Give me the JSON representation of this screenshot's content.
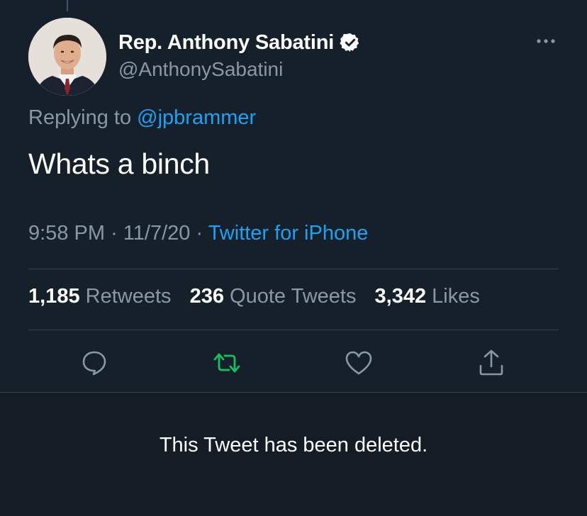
{
  "tweet": {
    "author": {
      "display_name": "Rep. Anthony Sabatini",
      "handle": "@AnthonySabatini",
      "verified": true
    },
    "replying_prefix": "Replying to",
    "replying_to": "@jpbrammer",
    "text": "Whats a binch",
    "time": "9:58 PM",
    "date": "11/7/20",
    "separator": "·",
    "source": "Twitter for iPhone",
    "stats": {
      "retweets_count": "1,185",
      "retweets_label": "Retweets",
      "quotes_count": "236",
      "quotes_label": "Quote Tweets",
      "likes_count": "3,342",
      "likes_label": "Likes"
    },
    "actions": [
      "reply-icon",
      "retweet-icon",
      "like-icon",
      "share-icon"
    ]
  },
  "deleted_notice": "This Tweet has been deleted.",
  "colors": {
    "background": "#15202b",
    "link": "#1da1f2",
    "muted": "#8899a6",
    "retweet_active": "#17bf63"
  }
}
